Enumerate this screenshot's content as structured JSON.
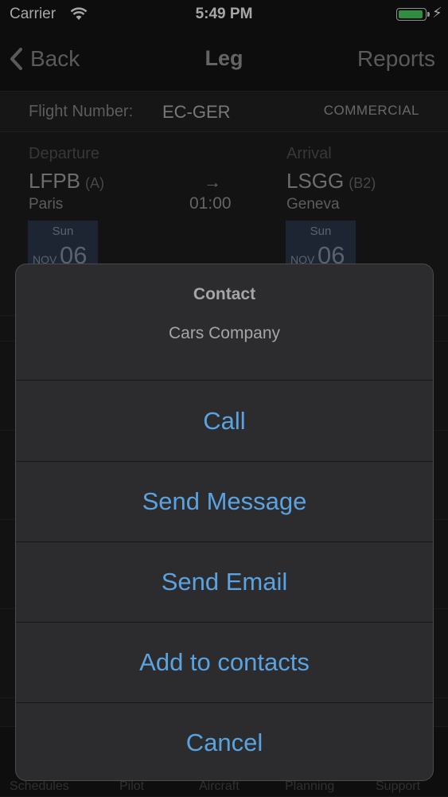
{
  "status_bar": {
    "carrier": "Carrier",
    "time": "5:49 PM",
    "battery_level": 1.0,
    "battery_color": "#4cd964"
  },
  "nav": {
    "back_label": "Back",
    "title": "Leg",
    "right_label": "Reports"
  },
  "flight": {
    "number_label": "Flight Number:",
    "number": "EC-GER",
    "type": "COMMERCIAL"
  },
  "departure": {
    "label": "Departure",
    "code": "LFPB",
    "code_suffix": "(A)",
    "city": "Paris",
    "day": "Sun",
    "month": "NOV",
    "date": "06"
  },
  "arrival": {
    "label": "Arrival",
    "code": "LSGG",
    "code_suffix": "(B2)",
    "city": "Geneva",
    "day": "Sun",
    "month": "NOV",
    "date": "06"
  },
  "duration": {
    "arrow": "→",
    "time": "01:00"
  },
  "tabs": [
    {
      "label": "Schedules"
    },
    {
      "label": "Pilot"
    },
    {
      "label": "Aircraft"
    },
    {
      "label": "Planning"
    },
    {
      "label": "Support"
    }
  ],
  "sheet": {
    "title": "Contact",
    "message": "Cars Company",
    "actions": [
      {
        "label": "Call"
      },
      {
        "label": "Send Message"
      },
      {
        "label": "Send Email"
      },
      {
        "label": "Add to contacts"
      },
      {
        "label": "Cancel"
      }
    ],
    "action_color": "#5aa3e0"
  }
}
